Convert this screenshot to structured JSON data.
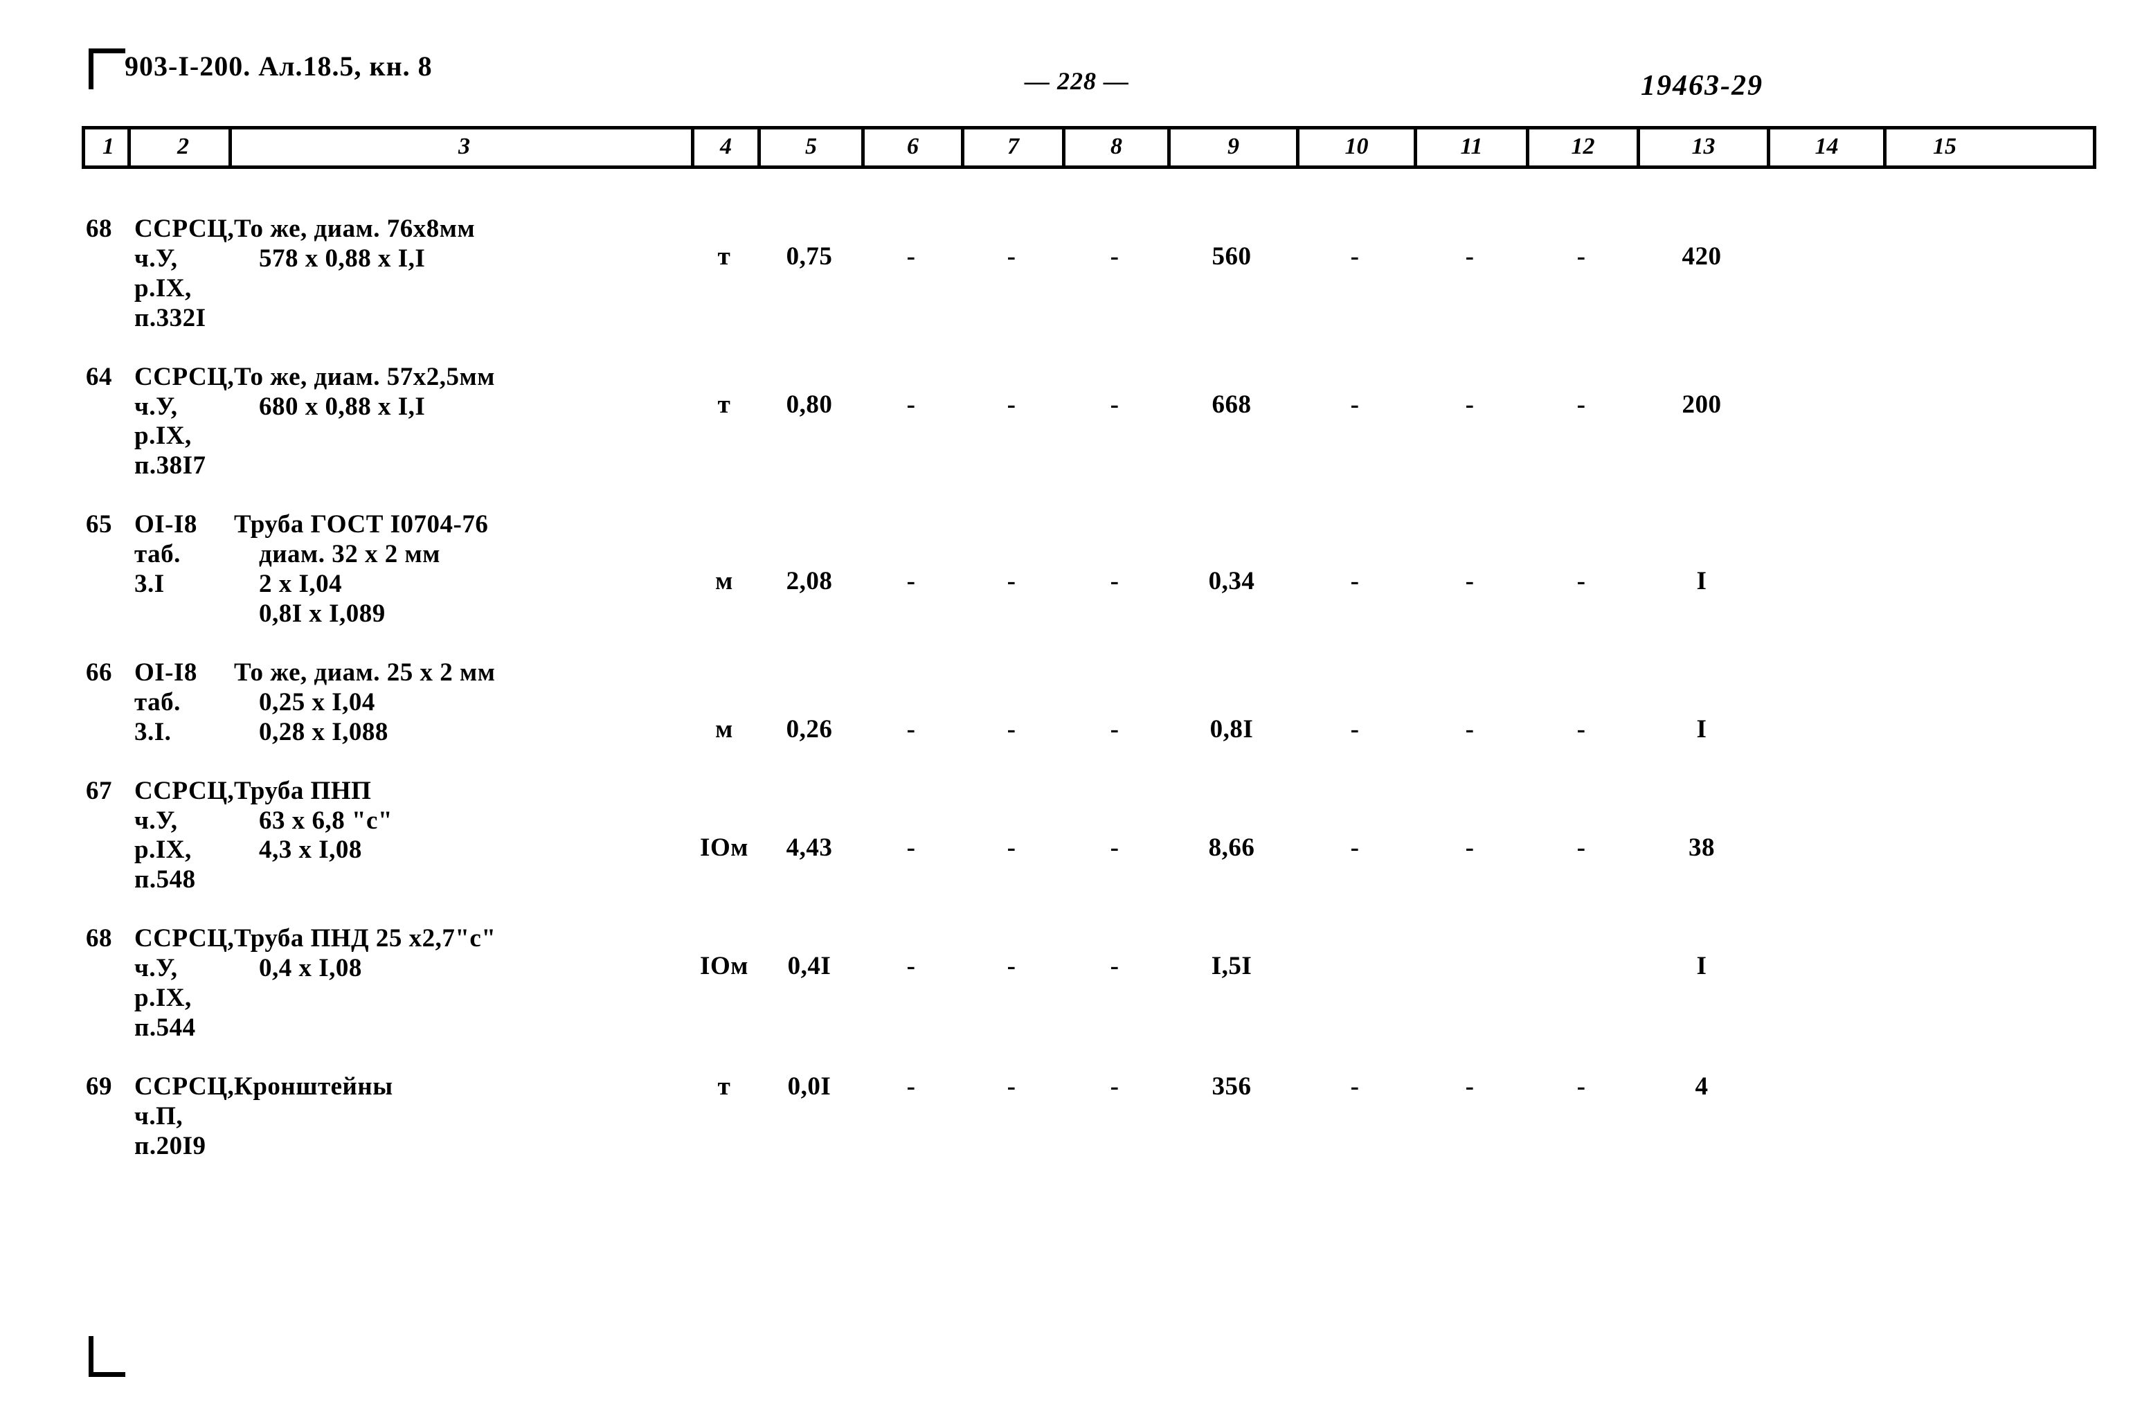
{
  "header": {
    "left": "903-I-200.  Ал.18.5, кн. 8",
    "page_number": "— 228 —",
    "right_code": "19463-29"
  },
  "column_numbers": [
    "1",
    "2",
    "3",
    "4",
    "5",
    "6",
    "7",
    "8",
    "9",
    "10",
    "11",
    "12",
    "13",
    "14",
    "15"
  ],
  "rows": [
    {
      "num": "68",
      "code": "ССРСЦ,\nч.У,\nр.IX,\nп.332I",
      "desc_line1": "То же, диам. 76х8мм",
      "desc_line2": "578 х 0,88 х I,I",
      "unit": "т",
      "c5": "0,75",
      "c6": "-",
      "c7": "-",
      "c8": "-",
      "c9": "560",
      "c10": "-",
      "c11": "-",
      "c12": "-",
      "c13": "420",
      "c14": "",
      "c15": ""
    },
    {
      "num": "64",
      "code": "ССРСЦ,\nч.У,\nр.IX,\nп.38I7",
      "desc_line1": "То же, диам. 57х2,5мм",
      "desc_line2": "680 х 0,88 х I,I",
      "unit": "т",
      "c5": "0,80",
      "c6": "-",
      "c7": "-",
      "c8": "-",
      "c9": "668",
      "c10": "-",
      "c11": "-",
      "c12": "-",
      "c13": "200",
      "c14": "",
      "c15": ""
    },
    {
      "num": "65",
      "code": "OI-I8\nтаб.\n3.I",
      "desc_line1": "Труба ГОСТ I0704-76",
      "desc_line2": "диам. 32 х 2 мм",
      "desc_line3": "2 х I,04",
      "desc_line4": "0,8I х I,089",
      "unit": "м",
      "c5": "2,08",
      "c6": "-",
      "c7": "-",
      "c8": "-",
      "c9": "0,34",
      "c10": "-",
      "c11": "-",
      "c12": "-",
      "c13": "I",
      "c14": "",
      "c15": ""
    },
    {
      "num": "66",
      "code": "OI-I8\nтаб.\n3.I.",
      "desc_line1": "То же, диам. 25 х 2 мм",
      "desc_line2": "0,25 х I,04",
      "desc_line3": "0,28 х I,088",
      "unit": "м",
      "c5": "0,26",
      "c6": "-",
      "c7": "-",
      "c8": "-",
      "c9": "0,8I",
      "c10": "-",
      "c11": "-",
      "c12": "-",
      "c13": "I",
      "c14": "",
      "c15": ""
    },
    {
      "num": "67",
      "code": "ССРСЦ,\nч.У,\nр.IX,\nп.548",
      "desc_line1": "Труба ПНП",
      "desc_line2": "63 х 6,8 \"с\"",
      "desc_line3": "4,3 х I,08",
      "unit": "IОм",
      "c5": "4,43",
      "c6": "-",
      "c7": "-",
      "c8": "-",
      "c9": "8,66",
      "c10": "-",
      "c11": "-",
      "c12": "-",
      "c13": "38",
      "c14": "",
      "c15": ""
    },
    {
      "num": "68",
      "code": "ССРСЦ,\nч.У,\nр.IX,\nп.544",
      "desc_line1": "Труба ПНД 25 х2,7\"с\"",
      "desc_line2": "0,4 х I,08",
      "unit": "IОм",
      "c5": "0,4I",
      "c6": "-",
      "c7": "-",
      "c8": "-",
      "c9": "I,5I",
      "c10": "",
      "c11": "",
      "c12": "",
      "c13": "I",
      "c14": "",
      "c15": ""
    },
    {
      "num": "69",
      "code": "ССРСЦ,\nч.П,\nп.20I9",
      "desc_line1": "Кронштейны",
      "desc_line2": "",
      "unit": "т",
      "c5": "0,0I",
      "c6": "-",
      "c7": "-",
      "c8": "-",
      "c9": "356",
      "c10": "-",
      "c11": "-",
      "c12": "-",
      "c13": "4",
      "c14": "",
      "c15": ""
    }
  ]
}
